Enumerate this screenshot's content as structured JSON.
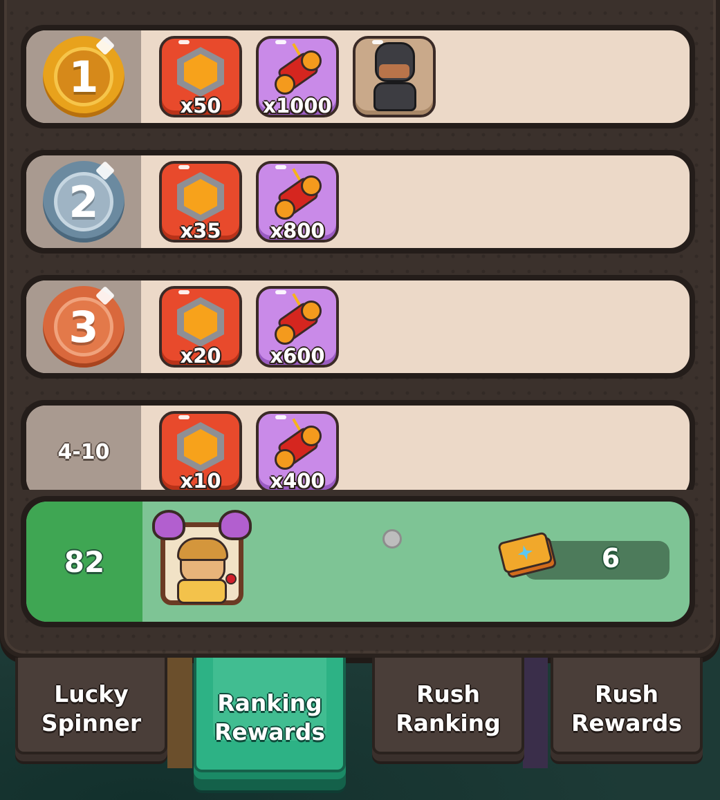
{
  "rows": [
    {
      "rank_label": "1",
      "medal": "gold-medal",
      "rewards": [
        {
          "type": "gem",
          "qty": "x50"
        },
        {
          "type": "spool",
          "qty": "x1000"
        },
        {
          "type": "ninja-avatar",
          "qty": ""
        }
      ]
    },
    {
      "rank_label": "2",
      "medal": "silver-medal",
      "rewards": [
        {
          "type": "gem",
          "qty": "x35"
        },
        {
          "type": "spool",
          "qty": "x800"
        }
      ]
    },
    {
      "rank_label": "3",
      "medal": "bronze-medal",
      "rewards": [
        {
          "type": "gem",
          "qty": "x20"
        },
        {
          "type": "spool",
          "qty": "x600"
        }
      ]
    },
    {
      "rank_label": "4-10",
      "medal": "",
      "rewards": [
        {
          "type": "gem",
          "qty": "x10"
        },
        {
          "type": "spool",
          "qty": "x400"
        }
      ]
    }
  ],
  "player": {
    "rank": "82",
    "ticket_count": "6",
    "avatar_icon": "horned-frame-avatar-icon",
    "ticket_icon": "golden-ticket-icon"
  },
  "tabs": [
    {
      "label_line1": "Lucky",
      "label_line2": "Spinner",
      "active": false
    },
    {
      "label_line1": "Ranking",
      "label_line2": "Rewards",
      "active": true
    },
    {
      "label_line1": "Rush",
      "label_line2": "Ranking",
      "active": false
    },
    {
      "label_line1": "Rush",
      "label_line2": "Rewards",
      "active": false
    }
  ],
  "colors": {
    "gem_tile": "#e84a2c",
    "spool_tile": "#c98ae8",
    "player_row": "#7ec495",
    "active_tab": "#2db285"
  }
}
